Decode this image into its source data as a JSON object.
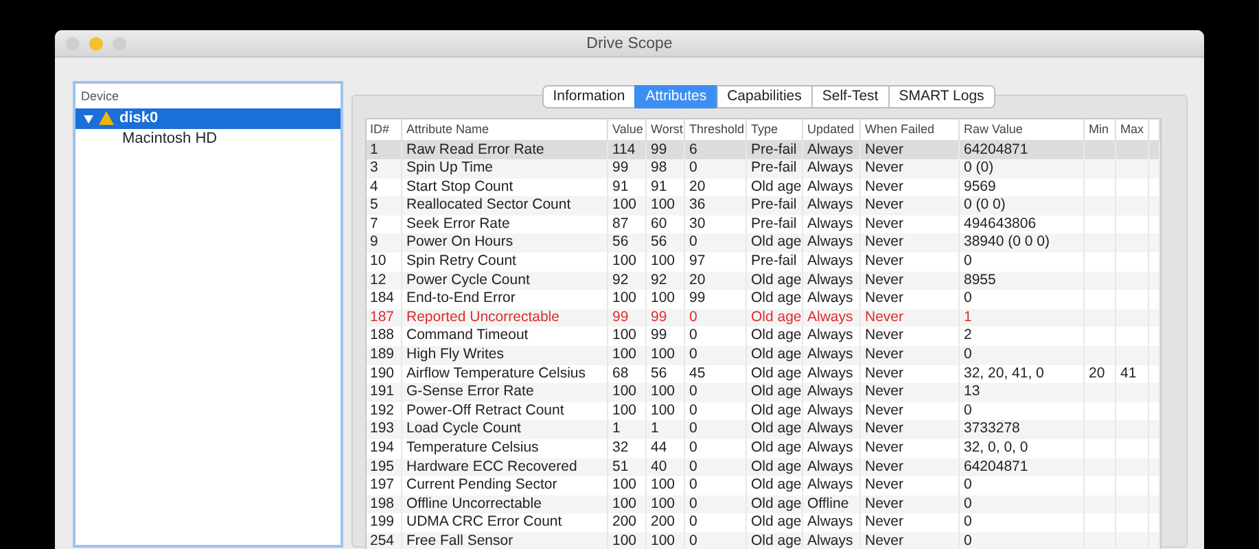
{
  "window": {
    "title": "Drive Scope"
  },
  "sidebar": {
    "header": "Device",
    "tree": [
      {
        "label": "disk0",
        "expanded": true,
        "warning": true,
        "selected": true,
        "children": [
          {
            "label": "Macintosh HD",
            "selected": false
          }
        ]
      }
    ]
  },
  "tabs": [
    {
      "label": "Information",
      "selected": false
    },
    {
      "label": "Attributes",
      "selected": true
    },
    {
      "label": "Capabilities",
      "selected": false
    },
    {
      "label": "Self-Test",
      "selected": false
    },
    {
      "label": "SMART Logs",
      "selected": false
    }
  ],
  "table": {
    "columns": [
      "ID#",
      "Attribute Name",
      "Value",
      "Worst",
      "Threshold",
      "Type",
      "Updated",
      "When Failed",
      "Raw Value",
      "Min",
      "Max"
    ],
    "rows": [
      {
        "cells": [
          "1",
          "Raw Read Error Rate",
          "114",
          "99",
          "6",
          "Pre-fail",
          "Always",
          "Never",
          "64204871"
        ],
        "selected": true,
        "alert": false
      },
      {
        "cells": [
          "3",
          "Spin Up Time",
          "99",
          "98",
          "0",
          "Pre-fail",
          "Always",
          "Never",
          "0 (0)"
        ],
        "selected": false,
        "alert": false
      },
      {
        "cells": [
          "4",
          "Start Stop Count",
          "91",
          "91",
          "20",
          "Old age",
          "Always",
          "Never",
          "9569"
        ],
        "selected": false,
        "alert": false
      },
      {
        "cells": [
          "5",
          "Reallocated Sector Count",
          "100",
          "100",
          "36",
          "Pre-fail",
          "Always",
          "Never",
          "0 (0 0)"
        ],
        "selected": false,
        "alert": false
      },
      {
        "cells": [
          "7",
          "Seek Error Rate",
          "87",
          "60",
          "30",
          "Pre-fail",
          "Always",
          "Never",
          "494643806"
        ],
        "selected": false,
        "alert": false
      },
      {
        "cells": [
          "9",
          "Power On Hours",
          "56",
          "56",
          "0",
          "Old age",
          "Always",
          "Never",
          "38940 (0 0 0)"
        ],
        "selected": false,
        "alert": false
      },
      {
        "cells": [
          "10",
          "Spin Retry Count",
          "100",
          "100",
          "97",
          "Pre-fail",
          "Always",
          "Never",
          "0"
        ],
        "selected": false,
        "alert": false
      },
      {
        "cells": [
          "12",
          "Power Cycle Count",
          "92",
          "92",
          "20",
          "Old age",
          "Always",
          "Never",
          "8955"
        ],
        "selected": false,
        "alert": false
      },
      {
        "cells": [
          "184",
          "End-to-End Error",
          "100",
          "100",
          "99",
          "Old age",
          "Always",
          "Never",
          "0"
        ],
        "selected": false,
        "alert": false
      },
      {
        "cells": [
          "187",
          "Reported Uncorrectable",
          "99",
          "99",
          "0",
          "Old age",
          "Always",
          "Never",
          "1"
        ],
        "selected": false,
        "alert": true
      },
      {
        "cells": [
          "188",
          "Command Timeout",
          "100",
          "99",
          "0",
          "Old age",
          "Always",
          "Never",
          "2"
        ],
        "selected": false,
        "alert": false
      },
      {
        "cells": [
          "189",
          "High Fly Writes",
          "100",
          "100",
          "0",
          "Old age",
          "Always",
          "Never",
          "0"
        ],
        "selected": false,
        "alert": false
      },
      {
        "cells": [
          "190",
          "Airflow Temperature Celsius",
          "68",
          "56",
          "45",
          "Old age",
          "Always",
          "Never",
          "32, 20, 41, 0",
          "20",
          "41"
        ],
        "selected": false,
        "alert": false
      },
      {
        "cells": [
          "191",
          "G-Sense Error Rate",
          "100",
          "100",
          "0",
          "Old age",
          "Always",
          "Never",
          "13"
        ],
        "selected": false,
        "alert": false
      },
      {
        "cells": [
          "192",
          "Power-Off Retract Count",
          "100",
          "100",
          "0",
          "Old age",
          "Always",
          "Never",
          "0"
        ],
        "selected": false,
        "alert": false
      },
      {
        "cells": [
          "193",
          "Load Cycle Count",
          "1",
          "1",
          "0",
          "Old age",
          "Always",
          "Never",
          "3733278"
        ],
        "selected": false,
        "alert": false
      },
      {
        "cells": [
          "194",
          "Temperature Celsius",
          "32",
          "44",
          "0",
          "Old age",
          "Always",
          "Never",
          "32, 0, 0, 0"
        ],
        "selected": false,
        "alert": false
      },
      {
        "cells": [
          "195",
          "Hardware ECC Recovered",
          "51",
          "40",
          "0",
          "Old age",
          "Always",
          "Never",
          "64204871"
        ],
        "selected": false,
        "alert": false
      },
      {
        "cells": [
          "197",
          "Current Pending Sector",
          "100",
          "100",
          "0",
          "Old age",
          "Always",
          "Never",
          "0"
        ],
        "selected": false,
        "alert": false
      },
      {
        "cells": [
          "198",
          "Offline Uncorrectable",
          "100",
          "100",
          "0",
          "Old age",
          "Offline",
          "Never",
          "0"
        ],
        "selected": false,
        "alert": false
      },
      {
        "cells": [
          "199",
          "UDMA CRC Error Count",
          "200",
          "200",
          "0",
          "Old age",
          "Always",
          "Never",
          "0"
        ],
        "selected": false,
        "alert": false
      },
      {
        "cells": [
          "254",
          "Free Fall Sensor",
          "100",
          "100",
          "0",
          "Old age",
          "Always",
          "Never",
          "0"
        ],
        "selected": false,
        "alert": false
      }
    ]
  }
}
